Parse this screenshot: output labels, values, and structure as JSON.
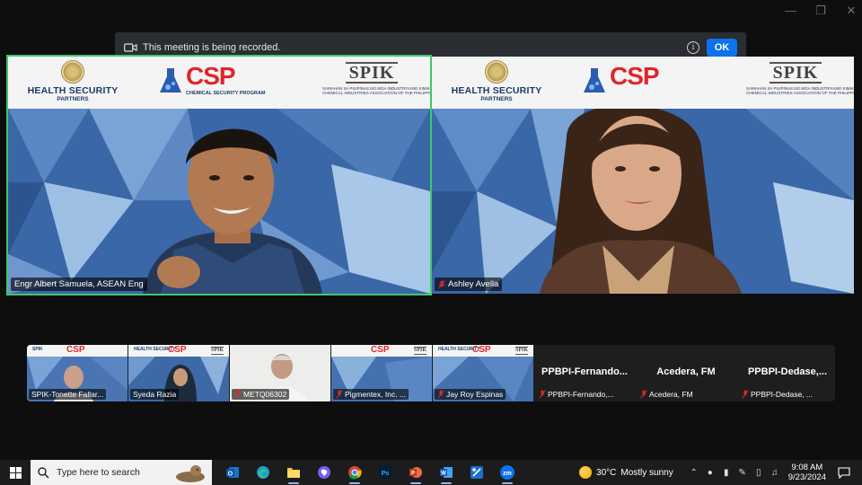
{
  "window": {
    "controls": [
      "minimize",
      "restore",
      "close"
    ]
  },
  "banner": {
    "message": "This meeting is being recorded.",
    "ok_label": "OK"
  },
  "logos": {
    "hsp_line1": "HEALTH SECURITY",
    "hsp_line2": "PARTNERS",
    "csp_word": "CSP",
    "csp_sub": "CHEMICAL SECURITY PROGRAM",
    "spik_word": "SPIK",
    "spik_sub1": "SAMAHAN SA PILIPINAS NG MGA INDUSTRIYANG KIMIKA",
    "spik_sub2": "CHEMICAL INDUSTRIES ASSOCIATION OF THE PHILIPPINES"
  },
  "main_tiles": [
    {
      "name": "Engr Albert Samuela, ASEAN Eng",
      "muted": false,
      "active": true
    },
    {
      "name": "Ashley Avella",
      "muted": true,
      "active": false
    }
  ],
  "strip": [
    {
      "name": "SPIK-Tonette Fallar...",
      "muted": false,
      "kind": "video"
    },
    {
      "name": "Syeda Razia",
      "muted": false,
      "kind": "video"
    },
    {
      "name": "METQ06302",
      "muted": true,
      "kind": "video"
    },
    {
      "name": "Pigmentex, Inc. ...",
      "muted": true,
      "kind": "video"
    },
    {
      "name": "Jay Roy Espinas",
      "muted": true,
      "kind": "video"
    },
    {
      "big": "PPBPI-Fernando...",
      "name": "PPBPI-Fernando,...",
      "muted": true,
      "kind": "nocam"
    },
    {
      "big": "Acedera, FM",
      "name": "Acedera, FM",
      "muted": true,
      "kind": "nocam"
    },
    {
      "big": "PPBPI-Dedase,...",
      "name": "PPBPI-Dedase, ...",
      "muted": true,
      "kind": "nocam"
    }
  ],
  "taskbar": {
    "search_placeholder": "Type here to search",
    "apps": [
      "outlook-icon",
      "edge-icon",
      "file-explorer-icon",
      "viber-icon",
      "chrome-icon",
      "photoshop-icon",
      "powerpoint-icon",
      "word-icon",
      "snipping-tool-icon",
      "zoom-icon"
    ],
    "weather_temp": "30°C",
    "weather_desc": "Mostly sunny",
    "time": "9:08 AM",
    "date": "9/23/2024"
  },
  "colors": {
    "active_speaker": "#3ec86b",
    "zoom_blue": "#0e72ed",
    "csp_red": "#e1252b",
    "muted_red": "#e02828"
  }
}
